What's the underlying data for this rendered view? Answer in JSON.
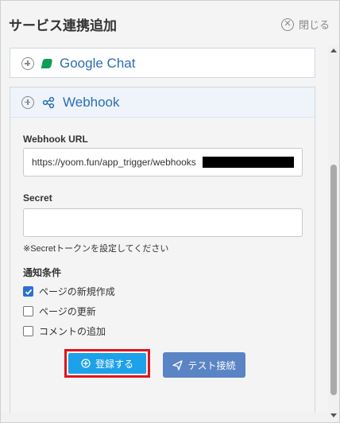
{
  "header": {
    "title": "サービス連携追加",
    "close_label": "閉じる"
  },
  "services": [
    {
      "name": "Google Chat",
      "icon": "google-chat-icon",
      "expanded": false
    },
    {
      "name": "Webhook",
      "icon": "webhook-icon",
      "expanded": true
    }
  ],
  "form": {
    "url_label": "Webhook URL",
    "url_value": "https://yoom.fun/app_trigger/webhooks",
    "secret_label": "Secret",
    "secret_value": "",
    "secret_hint": "※Secretトークンを設定してください",
    "conditions_label": "通知条件",
    "conditions": [
      {
        "label": "ページの新規作成",
        "checked": true
      },
      {
        "label": "ページの更新",
        "checked": false
      },
      {
        "label": "コメントの追加",
        "checked": false
      }
    ]
  },
  "actions": {
    "register_label": "登録する",
    "test_label": "テスト接続"
  },
  "colors": {
    "link_blue": "#2c6db4",
    "register_button": "#1da1e8",
    "test_button": "#5b84c4",
    "highlight_border": "#e0141c",
    "checkbox_checked": "#2e6fd1"
  }
}
